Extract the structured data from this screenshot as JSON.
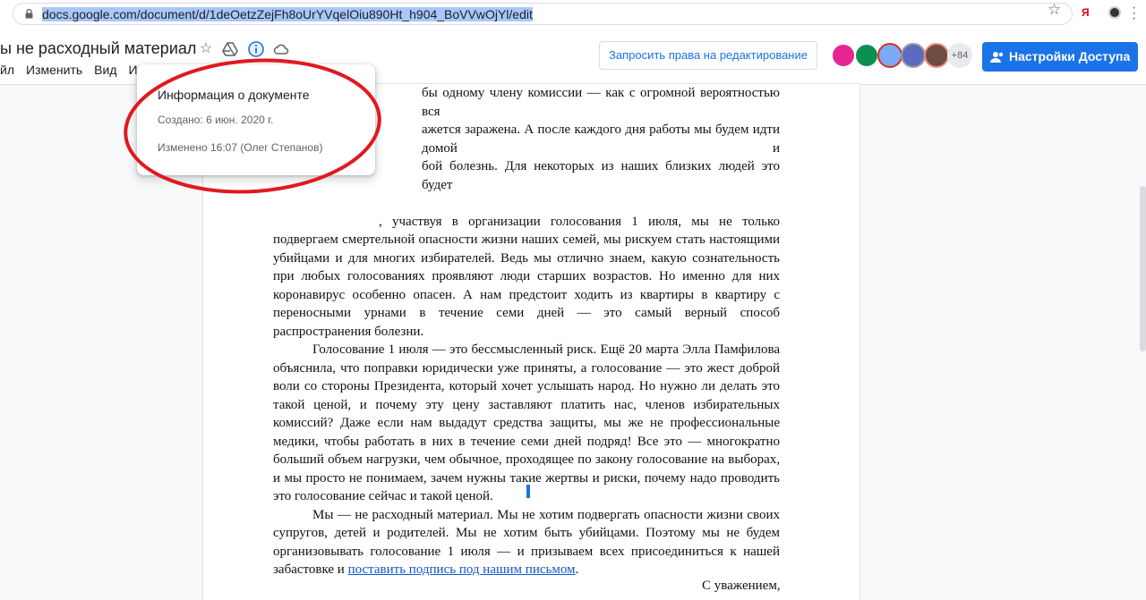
{
  "browser": {
    "url_selected": "docs.google.com/document/d/1deOetzZejFh8oUrYVqelOiu890Ht_h904_BoVVwOjYl/edit",
    "extension_label": "Я"
  },
  "docs": {
    "title": "ы не расходный материал",
    "menu": [
      "йл",
      "Изменить",
      "Вид",
      "Ин"
    ],
    "request_edit_label": "Запросить права на редактирование",
    "more_collaborators": "+84",
    "share_label": "Настройки Доступа"
  },
  "popup": {
    "title": "Информация о документе",
    "created": "Создано: 6 июн. 2020 г.",
    "modified": "Изменено 16:07 (Олег Степанов)"
  },
  "document": {
    "lines_top": [
      "бы одному члену комиссии — как с огромной вероятностью вся",
      "ажется заражена. А после каждого дня работы мы будем идти домой и",
      "бой болезнь. Для некоторых из наших близких людей это будет"
    ],
    "p1_tail": ", участвуя в организации голосования 1 июля, мы не только подвергаем смертельной опасности жизни наших семей, мы рискуем стать настоящими убийцами и для многих избирателей. Ведь мы отлично знаем, какую сознательность при любых голосованиях проявляют люди старших возрастов. Но именно для них коронавирус особенно опасен. А нам предстоит ходить из квартиры в квартиру с переносными урнами в течение семи дней — это самый верный способ распространения болезни.",
    "p2": "Голосование 1 июля — это бессмысленный риск. Ещё 20 марта Элла Памфилова объяснила, что поправки юридически уже приняты, а голосование — это жест доброй воли со стороны Президента, который хочет услышать народ. Но нужно ли делать это такой ценой, и почему эту цену заставляют платить нас, членов избирательных комиссий? Даже если нам выдадут средства защиты, мы же не профессиональные медики, чтобы работать в них в течение семи дней подряд! Все это — многократно больший объем нагрузки, чем обычное, проходящее по закону голосование на выборах, и мы просто не понимаем, зачем нужны такие жертвы и риски, почему надо проводить это голосование сейчас и такой ценой.",
    "p3_text": "Мы — не расходный материал. Мы не хотим подвергать опасности жизни своих супругов, детей и родителей. Мы не хотим быть убийцами. Поэтому мы не будем организовывать голосование 1 июля — и призываем всех присоединиться к нашей забастовке и ",
    "p3_link": "поставить подпись под нашим письмом",
    "p3_end": ".",
    "sign": "С уважением,"
  },
  "colors": {
    "accent": "#1a73e8",
    "annotation_circle": "#e0191f"
  }
}
